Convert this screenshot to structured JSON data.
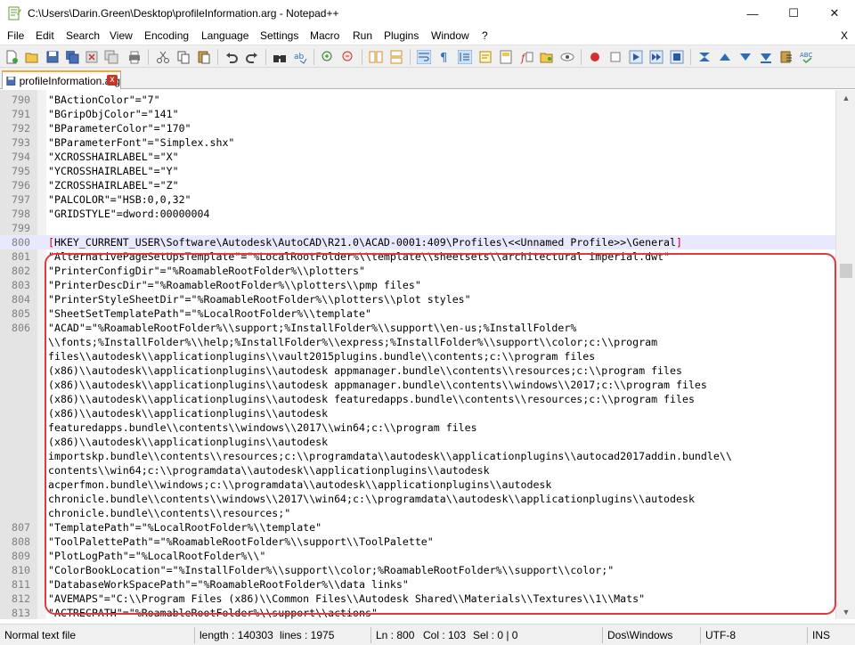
{
  "window": {
    "title": "C:\\Users\\Darin.Green\\Desktop\\profileInformation.arg - Notepad++",
    "minimize_glyph": "—",
    "maximize_glyph": "☐",
    "close_glyph": "✕"
  },
  "menu": {
    "items": [
      "File",
      "Edit",
      "Search",
      "View",
      "Encoding",
      "Language",
      "Settings",
      "Macro",
      "Run",
      "Plugins",
      "Window",
      "?"
    ],
    "close_label": "X"
  },
  "tab": {
    "label": "profileInformation.arg",
    "close_glyph": "x"
  },
  "editor": {
    "lines": [
      {
        "num": "790",
        "text": "\"BActionColor\"=\"7\""
      },
      {
        "num": "791",
        "text": "\"BGripObjColor\"=\"141\""
      },
      {
        "num": "792",
        "text": "\"BParameterColor\"=\"170\""
      },
      {
        "num": "793",
        "text": "\"BParameterFont\"=\"Simplex.shx\""
      },
      {
        "num": "794",
        "text": "\"XCROSSHAIRLABEL\"=\"X\""
      },
      {
        "num": "795",
        "text": "\"YCROSSHAIRLABEL\"=\"Y\""
      },
      {
        "num": "796",
        "text": "\"ZCROSSHAIRLABEL\"=\"Z\""
      },
      {
        "num": "797",
        "text": "\"PALCOLOR\"=\"HSB:0,0,32\""
      },
      {
        "num": "798",
        "text": "\"GRIDSTYLE\"=dword:00000004"
      },
      {
        "num": "799",
        "text": ""
      },
      {
        "num": "800",
        "text": "[HKEY_CURRENT_USER\\Software\\Autodesk\\AutoCAD\\R21.0\\ACAD-0001:409\\Profiles\\<<Unnamed Profile>>\\General]"
      },
      {
        "num": "801",
        "text": "\"AlternativePageSetUpsTemplate\"=\"%LocalRootFolder%\\\\template\\\\sheetsets\\\\architectural imperial.dwt\""
      },
      {
        "num": "802",
        "text": "\"PrinterConfigDir\"=\"%RoamableRootFolder%\\\\plotters\""
      },
      {
        "num": "803",
        "text": "\"PrinterDescDir\"=\"%RoamableRootFolder%\\\\plotters\\\\pmp files\""
      },
      {
        "num": "804",
        "text": "\"PrinterStyleSheetDir\"=\"%RoamableRootFolder%\\\\plotters\\\\plot styles\""
      },
      {
        "num": "805",
        "text": "\"SheetSetTemplatePath\"=\"%LocalRootFolder%\\\\template\""
      },
      {
        "num": "806",
        "text": "\"ACAD\"=\"%RoamableRootFolder%\\\\support;%InstallFolder%\\\\support\\\\en-us;%InstallFolder%"
      },
      {
        "num": "",
        "text": "\\\\fonts;%InstallFolder%\\\\help;%InstallFolder%\\\\express;%InstallFolder%\\\\support\\\\color;c:\\\\program"
      },
      {
        "num": "",
        "text": "files\\\\autodesk\\\\applicationplugins\\\\vault2015plugins.bundle\\\\contents;c:\\\\program files"
      },
      {
        "num": "",
        "text": "(x86)\\\\autodesk\\\\applicationplugins\\\\autodesk appmanager.bundle\\\\contents\\\\resources;c:\\\\program files"
      },
      {
        "num": "",
        "text": "(x86)\\\\autodesk\\\\applicationplugins\\\\autodesk appmanager.bundle\\\\contents\\\\windows\\\\2017;c:\\\\program files"
      },
      {
        "num": "",
        "text": "(x86)\\\\autodesk\\\\applicationplugins\\\\autodesk featuredapps.bundle\\\\contents\\\\resources;c:\\\\program files"
      },
      {
        "num": "",
        "text": "(x86)\\\\autodesk\\\\applicationplugins\\\\autodesk"
      },
      {
        "num": "",
        "text": "featuredapps.bundle\\\\contents\\\\windows\\\\2017\\\\win64;c:\\\\program files"
      },
      {
        "num": "",
        "text": "(x86)\\\\autodesk\\\\applicationplugins\\\\autodesk"
      },
      {
        "num": "",
        "text": "importskp.bundle\\\\contents\\\\resources;c:\\\\programdata\\\\autodesk\\\\applicationplugins\\\\autocad2017addin.bundle\\\\"
      },
      {
        "num": "",
        "text": "contents\\\\win64;c:\\\\programdata\\\\autodesk\\\\applicationplugins\\\\autodesk"
      },
      {
        "num": "",
        "text": "acperfmon.bundle\\\\windows;c:\\\\programdata\\\\autodesk\\\\applicationplugins\\\\autodesk"
      },
      {
        "num": "",
        "text": "chronicle.bundle\\\\contents\\\\windows\\\\2017\\\\win64;c:\\\\programdata\\\\autodesk\\\\applicationplugins\\\\autodesk"
      },
      {
        "num": "",
        "text": "chronicle.bundle\\\\contents\\\\resources;\""
      },
      {
        "num": "807",
        "text": "\"TemplatePath\"=\"%LocalRootFolder%\\\\template\""
      },
      {
        "num": "808",
        "text": "\"ToolPalettePath\"=\"%RoamableRootFolder%\\\\support\\\\ToolPalette\""
      },
      {
        "num": "809",
        "text": "\"PlotLogPath\"=\"%LocalRootFolder%\\\\\""
      },
      {
        "num": "810",
        "text": "\"ColorBookLocation\"=\"%InstallFolder%\\\\support\\\\color;%RoamableRootFolder%\\\\support\\\\color;\""
      },
      {
        "num": "811",
        "text": "\"DatabaseWorkSpacePath\"=\"%RoamableRootFolder%\\\\data links\""
      },
      {
        "num": "812",
        "text": "\"AVEMAPS\"=\"C:\\\\Program Files (x86)\\\\Common Files\\\\Autodesk Shared\\\\Materials\\\\Textures\\\\1\\\\Mats\""
      },
      {
        "num": "813",
        "text": "\"ACTRECPATH\"=\"%RoamableRootFolder%\\\\support\\\\actions\""
      }
    ],
    "current_line_index": 10
  },
  "status": {
    "file_type": "Normal text file",
    "length": "length : 140303",
    "lines": "lines : 1975",
    "ln": "Ln : 800",
    "col": "Col : 103",
    "sel": "Sel : 0 | 0",
    "eol": "Dos\\Windows",
    "encoding": "UTF-8",
    "mode": "INS"
  },
  "colors": {
    "highlight_border": "#e0393e",
    "tab_accent": "#f3a93a",
    "bracket": "#cc0000",
    "line_number": "#808080"
  }
}
